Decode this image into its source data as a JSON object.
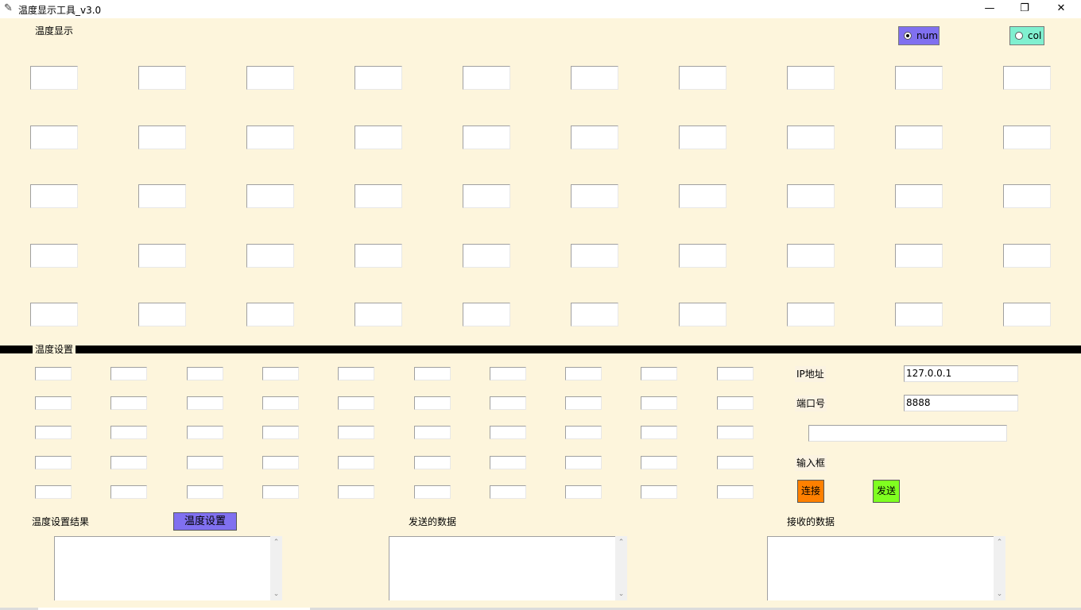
{
  "window": {
    "title": "温度显示工具_v3.0",
    "minimize_glyph": "—",
    "restore_glyph": "❐",
    "close_glyph": "✕"
  },
  "display_section": {
    "label": "温度显示",
    "mode_radio": [
      {
        "label": "num",
        "selected": true,
        "color": "#8070f0"
      },
      {
        "label": "col",
        "selected": false,
        "color": "#80f0d0"
      }
    ],
    "rows": 5,
    "cols": 10,
    "cell_values": [
      [
        "",
        "",
        "",
        "",
        "",
        "",
        "",
        "",
        "",
        ""
      ],
      [
        "",
        "",
        "",
        "",
        "",
        "",
        "",
        "",
        "",
        ""
      ],
      [
        "",
        "",
        "",
        "",
        "",
        "",
        "",
        "",
        "",
        ""
      ],
      [
        "",
        "",
        "",
        "",
        "",
        "",
        "",
        "",
        "",
        ""
      ],
      [
        "",
        "",
        "",
        "",
        "",
        "",
        "",
        "",
        "",
        ""
      ]
    ]
  },
  "settings_section": {
    "label": "温度设置",
    "rows": 5,
    "cols": 10,
    "cell_values": [
      [
        "",
        "",
        "",
        "",
        "",
        "",
        "",
        "",
        "",
        ""
      ],
      [
        "",
        "",
        "",
        "",
        "",
        "",
        "",
        "",
        "",
        ""
      ],
      [
        "",
        "",
        "",
        "",
        "",
        "",
        "",
        "",
        "",
        ""
      ],
      [
        "",
        "",
        "",
        "",
        "",
        "",
        "",
        "",
        "",
        ""
      ],
      [
        "",
        "",
        "",
        "",
        "",
        "",
        "",
        "",
        "",
        ""
      ]
    ]
  },
  "network": {
    "ip_label": "IP地址",
    "ip_value": "127.0.0.1",
    "port_label": "端口号",
    "port_value": "8888",
    "input_value": "",
    "input_label": "输入框",
    "connect_label": "连接",
    "connect_color": "#ff8000",
    "send_label": "发送",
    "send_color": "#80ff20"
  },
  "bottom": {
    "result_label": "温度设置结果",
    "set_button_label": "温度设置",
    "set_button_color": "#8070f0",
    "sent_label": "发送的数据",
    "received_label": "接收的数据",
    "result_text": "",
    "sent_text": "",
    "received_text": ""
  }
}
